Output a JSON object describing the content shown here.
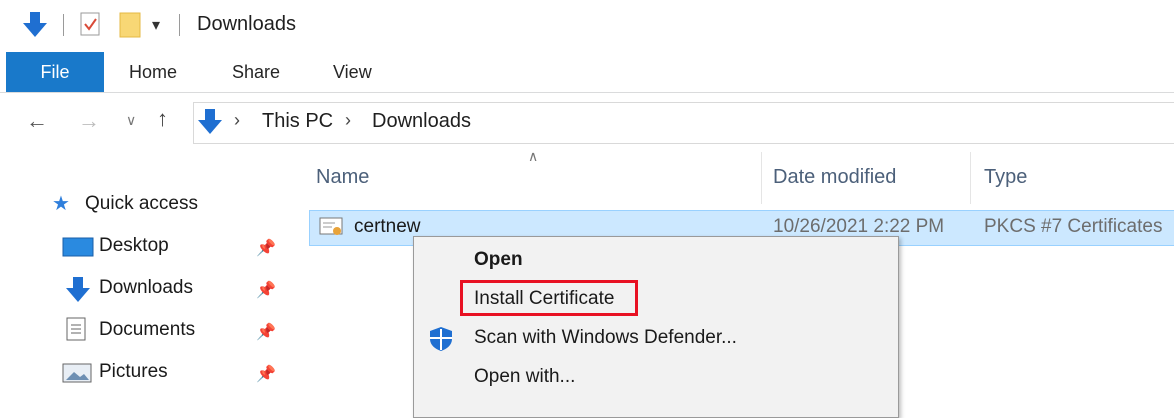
{
  "window": {
    "title": "Downloads"
  },
  "ribbon": {
    "tabs": [
      {
        "label": "File"
      },
      {
        "label": "Home"
      },
      {
        "label": "Share"
      },
      {
        "label": "View"
      }
    ]
  },
  "address": {
    "crumbs": [
      "This PC",
      "Downloads"
    ]
  },
  "columns": [
    "Name",
    "Date modified",
    "Type"
  ],
  "nav": {
    "quick_access": "Quick access",
    "items": [
      {
        "label": "Desktop",
        "icon": "desktop-icon"
      },
      {
        "label": "Downloads",
        "icon": "download-arrow-icon"
      },
      {
        "label": "Documents",
        "icon": "documents-icon"
      },
      {
        "label": "Pictures",
        "icon": "pictures-icon"
      }
    ]
  },
  "files": [
    {
      "name": "certnew",
      "date": "10/26/2021 2:22 PM",
      "type": "PKCS #7 Certificates"
    }
  ],
  "context_menu": {
    "items": [
      "Open",
      "Install Certificate",
      "Scan with Windows Defender...",
      "Open with..."
    ]
  },
  "colors": {
    "accent": "#1979ca",
    "selection": "#cce8ff",
    "highlight_box": "#e81123"
  }
}
